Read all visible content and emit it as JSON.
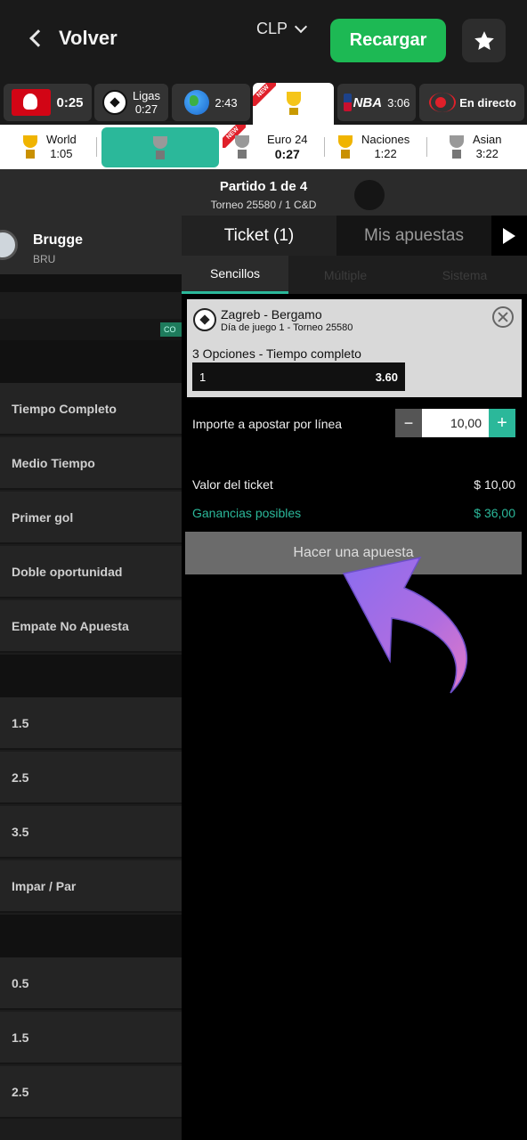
{
  "header": {
    "back_label": "Volver",
    "currency": "CLP",
    "recharge_label": "Recargar"
  },
  "sports": [
    {
      "name": "bundesliga",
      "time": "0:25"
    },
    {
      "name": "ligas",
      "label": "Ligas",
      "time": "0:27"
    },
    {
      "name": "world",
      "time": "2:43"
    },
    {
      "name": "trophy",
      "badge": "NEW"
    },
    {
      "name": "nba",
      "label": "NBA",
      "time": "3:06"
    },
    {
      "name": "live",
      "label": "En directo"
    }
  ],
  "tournaments": [
    {
      "name": "World",
      "time": "1:05"
    },
    {
      "name": "Euro 24",
      "time": "0:27",
      "badge": "NEW"
    },
    {
      "name": "Naciones",
      "time": "1:22"
    },
    {
      "name": "Asian",
      "time": "3:22"
    }
  ],
  "match": {
    "title": "Partido 1 de 4",
    "subtitle": "Torneo 25580 / 1 C&D"
  },
  "team": {
    "name": "Brugge",
    "code": "BRU",
    "chip": "CO"
  },
  "markets": [
    "Tiempo Completo",
    "Medio Tiempo",
    "Primer gol",
    "Doble oportunidad",
    "Empate No Apuesta",
    "1.5",
    "2.5",
    "3.5",
    "Impar / Par",
    "0.5",
    "1.5",
    "2.5"
  ],
  "ticket": {
    "tab_ticket": "Ticket (1)",
    "tab_mis": "Mis apuestas",
    "sub_tabs": [
      "Sencillos",
      "Múltiple",
      "Sistema"
    ],
    "bet": {
      "teams": "Zagreb - Bergamo",
      "day": "Día de juego 1 - Torneo 25580",
      "market": "3 Opciones - Tiempo completo",
      "selection": "1",
      "odds": "3.60"
    },
    "stake_label": "Importe a apostar por línea",
    "stake_value": "10,00",
    "ticket_value_label": "Valor del ticket",
    "ticket_value": "$ 10,00",
    "winnings_label": "Ganancias posibles",
    "winnings": "$ 36,00",
    "place_bet_label": "Hacer una apuesta"
  },
  "colors": {
    "accent": "#2bb89a",
    "recharge": "#1db954",
    "arrow": "#b06de0"
  }
}
